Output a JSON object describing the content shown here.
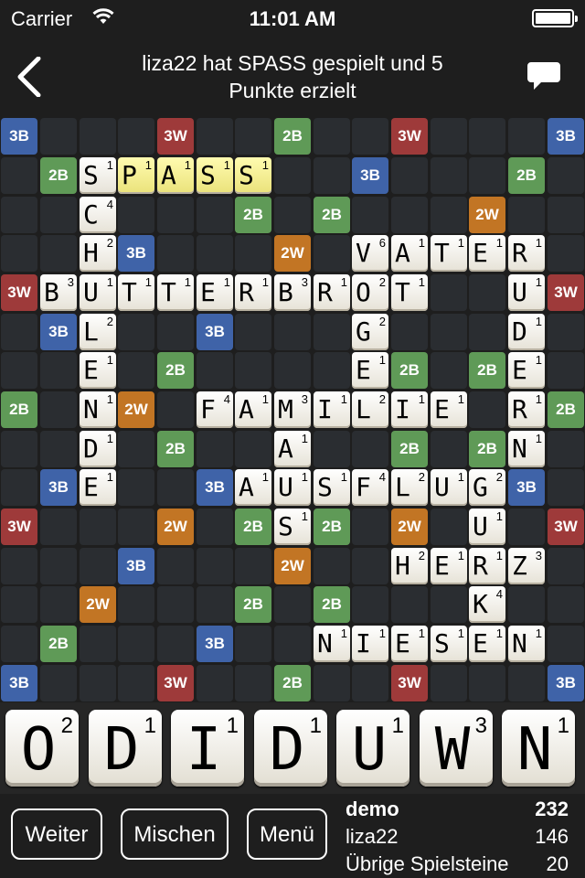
{
  "status": {
    "carrier": "Carrier",
    "time": "11:01 AM"
  },
  "nav": {
    "title_line1": "liza22 hat SPASS gespielt und 5",
    "title_line2": "Punkte erzielt"
  },
  "colors": {
    "3W": "#9e3a3a",
    "2W": "#c27524",
    "2B": "#5f9a57",
    "3B": "#3f63a8"
  },
  "board": {
    "bonus": [
      {
        "r": 0,
        "c": 0,
        "t": "3B"
      },
      {
        "r": 0,
        "c": 4,
        "t": "3W"
      },
      {
        "r": 0,
        "c": 7,
        "t": "2B"
      },
      {
        "r": 0,
        "c": 10,
        "t": "3W"
      },
      {
        "r": 0,
        "c": 14,
        "t": "3B"
      },
      {
        "r": 1,
        "c": 1,
        "t": "2B"
      },
      {
        "r": 1,
        "c": 9,
        "t": "3B"
      },
      {
        "r": 1,
        "c": 13,
        "t": "2B"
      },
      {
        "r": 2,
        "c": 6,
        "t": "2B"
      },
      {
        "r": 2,
        "c": 8,
        "t": "2B"
      },
      {
        "r": 2,
        "c": 12,
        "t": "2W"
      },
      {
        "r": 3,
        "c": 3,
        "t": "3B"
      },
      {
        "r": 3,
        "c": 7,
        "t": "2W"
      },
      {
        "r": 4,
        "c": 0,
        "t": "3W"
      },
      {
        "r": 4,
        "c": 14,
        "t": "3W"
      },
      {
        "r": 5,
        "c": 1,
        "t": "3B"
      },
      {
        "r": 5,
        "c": 5,
        "t": "3B"
      },
      {
        "r": 6,
        "c": 4,
        "t": "2B"
      },
      {
        "r": 6,
        "c": 10,
        "t": "2B"
      },
      {
        "r": 6,
        "c": 12,
        "t": "2B"
      },
      {
        "r": 7,
        "c": 0,
        "t": "2B"
      },
      {
        "r": 7,
        "c": 3,
        "t": "2W"
      },
      {
        "r": 7,
        "c": 14,
        "t": "2B"
      },
      {
        "r": 8,
        "c": 4,
        "t": "2B"
      },
      {
        "r": 8,
        "c": 10,
        "t": "2B"
      },
      {
        "r": 8,
        "c": 12,
        "t": "2B"
      },
      {
        "r": 9,
        "c": 1,
        "t": "3B"
      },
      {
        "r": 9,
        "c": 5,
        "t": "3B"
      },
      {
        "r": 9,
        "c": 13,
        "t": "3B"
      },
      {
        "r": 10,
        "c": 0,
        "t": "3W"
      },
      {
        "r": 10,
        "c": 4,
        "t": "2W"
      },
      {
        "r": 10,
        "c": 6,
        "t": "2B"
      },
      {
        "r": 10,
        "c": 8,
        "t": "2B"
      },
      {
        "r": 10,
        "c": 10,
        "t": "2W"
      },
      {
        "r": 10,
        "c": 14,
        "t": "3W"
      },
      {
        "r": 11,
        "c": 3,
        "t": "3B"
      },
      {
        "r": 11,
        "c": 7,
        "t": "2W"
      },
      {
        "r": 12,
        "c": 2,
        "t": "2W"
      },
      {
        "r": 12,
        "c": 6,
        "t": "2B"
      },
      {
        "r": 12,
        "c": 8,
        "t": "2B"
      },
      {
        "r": 13,
        "c": 1,
        "t": "2B"
      },
      {
        "r": 13,
        "c": 5,
        "t": "3B"
      },
      {
        "r": 14,
        "c": 0,
        "t": "3B"
      },
      {
        "r": 14,
        "c": 4,
        "t": "3W"
      },
      {
        "r": 14,
        "c": 7,
        "t": "2B"
      },
      {
        "r": 14,
        "c": 10,
        "t": "3W"
      },
      {
        "r": 14,
        "c": 14,
        "t": "3B"
      }
    ],
    "tiles": [
      {
        "r": 1,
        "c": 2,
        "l": "S",
        "p": "1"
      },
      {
        "r": 1,
        "c": 3,
        "l": "P",
        "p": "1",
        "hl": true
      },
      {
        "r": 1,
        "c": 4,
        "l": "A",
        "p": "1",
        "hl": true
      },
      {
        "r": 1,
        "c": 5,
        "l": "S",
        "p": "1",
        "hl": true
      },
      {
        "r": 1,
        "c": 6,
        "l": "S",
        "p": "1",
        "hl": true
      },
      {
        "r": 2,
        "c": 2,
        "l": "C",
        "p": "4"
      },
      {
        "r": 3,
        "c": 2,
        "l": "H",
        "p": "2"
      },
      {
        "r": 3,
        "c": 9,
        "l": "V",
        "p": "6"
      },
      {
        "r": 3,
        "c": 10,
        "l": "A",
        "p": "1"
      },
      {
        "r": 3,
        "c": 11,
        "l": "T",
        "p": "1"
      },
      {
        "r": 3,
        "c": 12,
        "l": "E",
        "p": "1"
      },
      {
        "r": 3,
        "c": 13,
        "l": "R",
        "p": "1"
      },
      {
        "r": 4,
        "c": 1,
        "l": "B",
        "p": "3"
      },
      {
        "r": 4,
        "c": 2,
        "l": "U",
        "p": "1"
      },
      {
        "r": 4,
        "c": 3,
        "l": "T",
        "p": "1"
      },
      {
        "r": 4,
        "c": 4,
        "l": "T",
        "p": "1"
      },
      {
        "r": 4,
        "c": 5,
        "l": "E",
        "p": "1"
      },
      {
        "r": 4,
        "c": 6,
        "l": "R",
        "p": "1"
      },
      {
        "r": 4,
        "c": 7,
        "l": "B",
        "p": "3"
      },
      {
        "r": 4,
        "c": 8,
        "l": "R",
        "p": "1"
      },
      {
        "r": 4,
        "c": 9,
        "l": "O",
        "p": "2"
      },
      {
        "r": 4,
        "c": 10,
        "l": "T",
        "p": "1"
      },
      {
        "r": 4,
        "c": 13,
        "l": "U",
        "p": "1"
      },
      {
        "r": 5,
        "c": 2,
        "l": "L",
        "p": "2"
      },
      {
        "r": 5,
        "c": 9,
        "l": "G",
        "p": "2"
      },
      {
        "r": 5,
        "c": 13,
        "l": "D",
        "p": "1"
      },
      {
        "r": 6,
        "c": 2,
        "l": "E",
        "p": "1"
      },
      {
        "r": 6,
        "c": 9,
        "l": "E",
        "p": "1"
      },
      {
        "r": 6,
        "c": 13,
        "l": "E",
        "p": "1"
      },
      {
        "r": 7,
        "c": 2,
        "l": "N",
        "p": "1"
      },
      {
        "r": 7,
        "c": 5,
        "l": "F",
        "p": "4"
      },
      {
        "r": 7,
        "c": 6,
        "l": "A",
        "p": "1"
      },
      {
        "r": 7,
        "c": 7,
        "l": "M",
        "p": "3"
      },
      {
        "r": 7,
        "c": 8,
        "l": "I",
        "p": "1"
      },
      {
        "r": 7,
        "c": 9,
        "l": "L",
        "p": "2"
      },
      {
        "r": 7,
        "c": 10,
        "l": "I",
        "p": "1"
      },
      {
        "r": 7,
        "c": 11,
        "l": "E",
        "p": "1"
      },
      {
        "r": 7,
        "c": 13,
        "l": "R",
        "p": "1"
      },
      {
        "r": 8,
        "c": 2,
        "l": "D",
        "p": "1"
      },
      {
        "r": 8,
        "c": 7,
        "l": "A",
        "p": "1"
      },
      {
        "r": 8,
        "c": 13,
        "l": "N",
        "p": "1"
      },
      {
        "r": 9,
        "c": 2,
        "l": "E",
        "p": "1"
      },
      {
        "r": 9,
        "c": 6,
        "l": "A",
        "p": "1"
      },
      {
        "r": 9,
        "c": 7,
        "l": "U",
        "p": "1"
      },
      {
        "r": 9,
        "c": 8,
        "l": "S",
        "p": "1"
      },
      {
        "r": 9,
        "c": 9,
        "l": "F",
        "p": "4"
      },
      {
        "r": 9,
        "c": 10,
        "l": "L",
        "p": "2"
      },
      {
        "r": 9,
        "c": 11,
        "l": "U",
        "p": "1"
      },
      {
        "r": 9,
        "c": 12,
        "l": "G",
        "p": "2"
      },
      {
        "r": 10,
        "c": 7,
        "l": "S",
        "p": "1"
      },
      {
        "r": 10,
        "c": 12,
        "l": "U",
        "p": "1"
      },
      {
        "r": 11,
        "c": 10,
        "l": "H",
        "p": "2"
      },
      {
        "r": 11,
        "c": 11,
        "l": "E",
        "p": "1"
      },
      {
        "r": 11,
        "c": 12,
        "l": "R",
        "p": "1"
      },
      {
        "r": 11,
        "c": 13,
        "l": "Z",
        "p": "3"
      },
      {
        "r": 12,
        "c": 12,
        "l": "K",
        "p": "4"
      },
      {
        "r": 13,
        "c": 8,
        "l": "N",
        "p": "1"
      },
      {
        "r": 13,
        "c": 9,
        "l": "I",
        "p": "1"
      },
      {
        "r": 13,
        "c": 10,
        "l": "E",
        "p": "1"
      },
      {
        "r": 13,
        "c": 11,
        "l": "S",
        "p": "1"
      },
      {
        "r": 13,
        "c": 12,
        "l": "E",
        "p": "1"
      },
      {
        "r": 13,
        "c": 13,
        "l": "N",
        "p": "1"
      }
    ]
  },
  "rack": [
    {
      "l": "O",
      "p": "2"
    },
    {
      "l": "D",
      "p": "1"
    },
    {
      "l": "I",
      "p": "1"
    },
    {
      "l": "D",
      "p": "1"
    },
    {
      "l": "U",
      "p": "1"
    },
    {
      "l": "W",
      "p": "3"
    },
    {
      "l": "N",
      "p": "1"
    }
  ],
  "buttons": {
    "weiter": "Weiter",
    "mischen": "Mischen",
    "menu": "Menü"
  },
  "scores": {
    "player1_name": "demo",
    "player1_score": "232",
    "player2_name": "liza22",
    "player2_score": "146",
    "remaining_label": "Übrige Spielsteine",
    "remaining_value": "20"
  }
}
